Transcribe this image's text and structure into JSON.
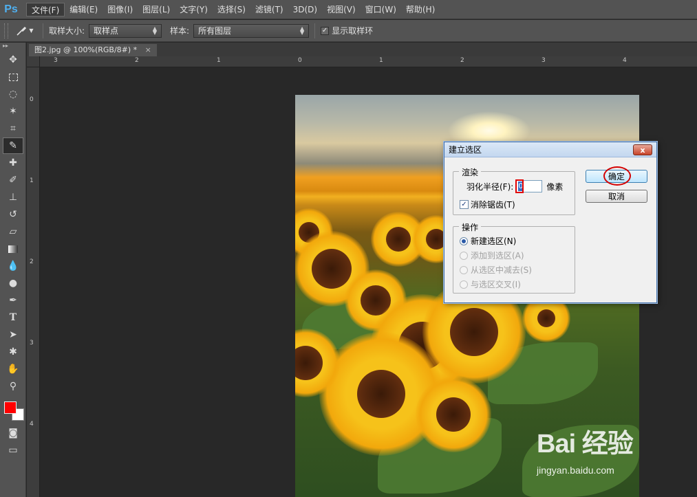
{
  "app": {
    "logo": "Ps"
  },
  "menubar": {
    "items": [
      "文件(F)",
      "编辑(E)",
      "图像(I)",
      "图层(L)",
      "文字(Y)",
      "选择(S)",
      "滤镜(T)",
      "3D(D)",
      "视图(V)",
      "窗口(W)",
      "帮助(H)"
    ]
  },
  "options": {
    "sample_size_label": "取样大小:",
    "sample_size_value": "取样点",
    "sample_label": "样本:",
    "sample_value": "所有图层",
    "show_ring_label": "显示取样环",
    "show_ring_checked": true
  },
  "document": {
    "tab_title": "图2.jpg @ 100%(RGB/8#) *",
    "close_symbol": "×"
  },
  "ruler": {
    "h_labels": [
      "3",
      "2",
      "1",
      "0",
      "1",
      "2",
      "3",
      "4"
    ],
    "v_labels": [
      "0",
      "1",
      "2",
      "3",
      "4"
    ]
  },
  "colors": {
    "foreground": "#ff0000",
    "background": "#ffffff"
  },
  "tools": [
    "move-icon",
    "marquee-icon",
    "lasso-icon",
    "magic-wand-icon",
    "crop-icon",
    "eyedropper-icon",
    "healing-icon",
    "brush-icon",
    "stamp-icon",
    "history-brush-icon",
    "eraser-icon",
    "gradient-icon",
    "blur-icon",
    "dodge-icon",
    "pen-icon",
    "type-icon",
    "path-select-icon",
    "shape-icon",
    "hand-icon",
    "zoom-icon"
  ],
  "dialog": {
    "title": "建立选区",
    "close_symbol": "x",
    "render_group": "渲染",
    "feather_label": "羽化半径(F):",
    "feather_value": "0",
    "feather_unit": "像素",
    "antialias_label": "消除锯齿(T)",
    "antialias_checked": true,
    "operation_group": "操作",
    "operations": [
      {
        "label": "新建选区(N)",
        "selected": true,
        "enabled": true
      },
      {
        "label": "添加到选区(A)",
        "selected": false,
        "enabled": false
      },
      {
        "label": "从选区中减去(S)",
        "selected": false,
        "enabled": false
      },
      {
        "label": "与选区交叉(I)",
        "selected": false,
        "enabled": false
      }
    ],
    "ok_label": "确定",
    "cancel_label": "取消"
  },
  "watermark": {
    "logo": "Bai 经验",
    "url": "jingyan.baidu.com"
  }
}
